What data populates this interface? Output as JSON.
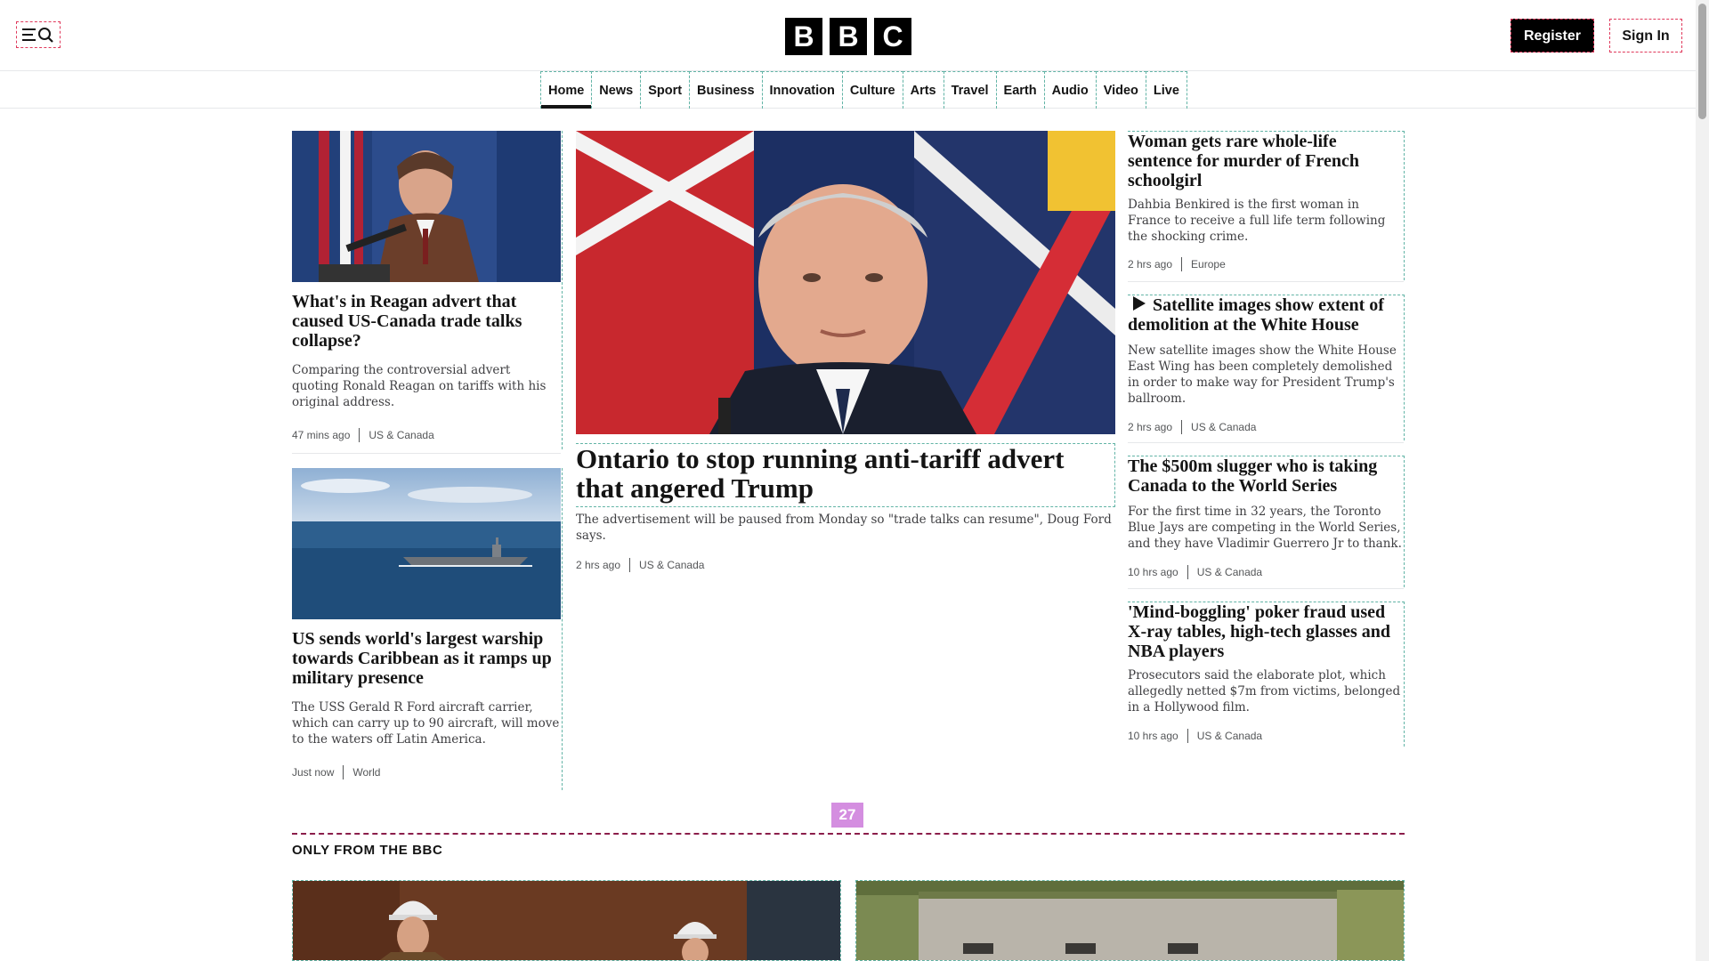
{
  "header": {
    "menu_icon": "menu-search-icon",
    "logo": [
      "B",
      "B",
      "C"
    ],
    "register_label": "Register",
    "signin_label": "Sign In"
  },
  "nav": {
    "items": [
      "Home",
      "News",
      "Sport",
      "Business",
      "Innovation",
      "Culture",
      "Arts",
      "Travel",
      "Earth",
      "Audio",
      "Video",
      "Live"
    ],
    "active": "Home"
  },
  "stories": {
    "left": [
      {
        "headline": "What's in Reagan advert that caused US-Canada trade talks collapse?",
        "summary": "Comparing the controversial advert quoting Ronald Reagan on tariffs with his original address.",
        "time": "47 mins ago",
        "tag": "US & Canada"
      },
      {
        "headline": "US sends world's largest warship towards Caribbean as it ramps up military presence",
        "summary": "The USS Gerald R Ford aircraft carrier, which can carry up to 90 aircraft, will move to the waters off Latin America.",
        "time": "Just now",
        "tag": "World"
      }
    ],
    "main": {
      "headline": "Ontario to stop running anti-tariff advert that angered Trump",
      "summary": "The advertisement will be paused from Monday so \"trade talks can resume\", Doug Ford says.",
      "time": "2 hrs ago",
      "tag": "US & Canada"
    },
    "right": [
      {
        "headline": "Woman gets rare whole-life sentence for murder of French schoolgirl",
        "summary": "Dahbia Benkired is the first woman in France to receive a full life term following the shocking crime.",
        "time": "2 hrs ago",
        "tag": "Europe"
      },
      {
        "headline": "Satellite images show extent of demolition at the White House",
        "summary": "New satellite images show the White House East Wing has been completely demolished in order to make way for President Trump's ballroom.",
        "time": "2 hrs ago",
        "tag": "US & Canada",
        "icon": "play-icon"
      },
      {
        "headline": "The $500m slugger who is taking Canada to the World Series",
        "summary": "For the first time in 32 years, the Toronto Blue Jays are competing in the World Series, and they have Vladimir Guerrero Jr to thank.",
        "time": "10 hrs ago",
        "tag": "US & Canada"
      },
      {
        "headline": "'Mind-boggling' poker fraud used X-ray tables, high-tech glasses and NBA players",
        "summary": "Prosecutors said the elaborate plot, which allegedly netted $7m from victims, belonged in a Hollywood film.",
        "time": "10 hrs ago",
        "tag": "US & Canada"
      }
    ]
  },
  "badge": "27",
  "section": {
    "title": "ONLY FROM THE BBC"
  },
  "colors": {
    "brand": "#000000",
    "accent_dashed": "#62b4a6",
    "section_rule": "#8b1e4a",
    "badge": "#d48ee0"
  }
}
